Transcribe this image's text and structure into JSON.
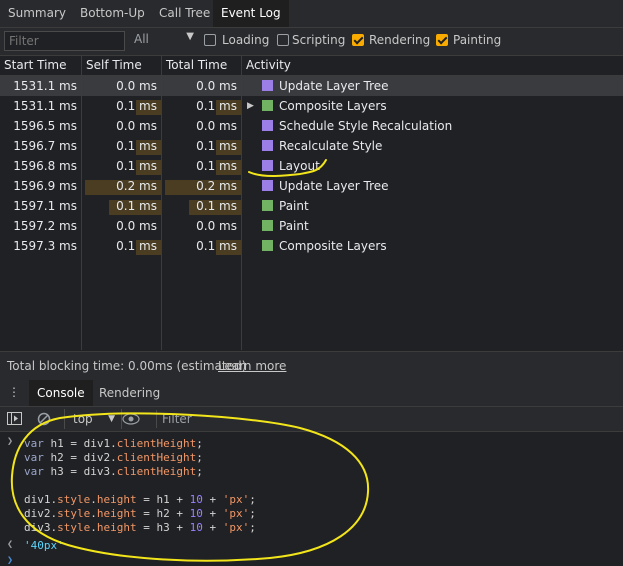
{
  "tabs": [
    {
      "label": "Summary",
      "active": false
    },
    {
      "label": "Bottom-Up",
      "active": false
    },
    {
      "label": "Call Tree",
      "active": false
    },
    {
      "label": "Event Log",
      "active": true
    }
  ],
  "filter": {
    "placeholder": "Filter",
    "level_select": "All",
    "checkboxes": [
      {
        "label": "Loading",
        "checked": false
      },
      {
        "label": "Scripting",
        "checked": false
      },
      {
        "label": "Rendering",
        "checked": true
      },
      {
        "label": "Painting",
        "checked": true
      }
    ]
  },
  "table": {
    "headers": [
      "Start Time",
      "Self Time",
      "Total Time",
      "Activity"
    ],
    "rows": [
      {
        "start": "1531.1 ms",
        "self": "0.0 ms",
        "total": "0.0 ms",
        "activity": "Update Layer Tree",
        "category": "rendering",
        "selected": true,
        "self_fraction": 0.0,
        "total_fraction": 0.0,
        "expandable": false
      },
      {
        "start": "1531.1 ms",
        "self": "0.1 ms",
        "total": "0.1 ms",
        "activity": "Composite Layers",
        "category": "painting",
        "selected": false,
        "self_fraction": 0.35,
        "total_fraction": 0.35,
        "expandable": true
      },
      {
        "start": "1596.5 ms",
        "self": "0.0 ms",
        "total": "0.0 ms",
        "activity": "Schedule Style Recalculation",
        "category": "rendering",
        "selected": false,
        "self_fraction": 0.0,
        "total_fraction": 0.0,
        "expandable": false
      },
      {
        "start": "1596.7 ms",
        "self": "0.1 ms",
        "total": "0.1 ms",
        "activity": "Recalculate Style",
        "category": "rendering",
        "selected": false,
        "self_fraction": 0.35,
        "total_fraction": 0.35,
        "expandable": false
      },
      {
        "start": "1596.8 ms",
        "self": "0.1 ms",
        "total": "0.1 ms",
        "activity": "Layout",
        "category": "rendering",
        "selected": false,
        "self_fraction": 0.35,
        "total_fraction": 0.35,
        "expandable": false
      },
      {
        "start": "1596.9 ms",
        "self": "0.2 ms",
        "total": "0.2 ms",
        "activity": "Update Layer Tree",
        "category": "rendering",
        "selected": false,
        "self_fraction": 1.0,
        "total_fraction": 1.0,
        "expandable": false
      },
      {
        "start": "1597.1 ms",
        "self": "0.1 ms",
        "total": "0.1 ms",
        "activity": "Paint",
        "category": "painting",
        "selected": false,
        "self_fraction": 0.7,
        "total_fraction": 0.7,
        "expandable": false
      },
      {
        "start": "1597.2 ms",
        "self": "0.0 ms",
        "total": "0.0 ms",
        "activity": "Paint",
        "category": "painting",
        "selected": false,
        "self_fraction": 0.0,
        "total_fraction": 0.0,
        "expandable": false
      },
      {
        "start": "1597.3 ms",
        "self": "0.1 ms",
        "total": "0.1 ms",
        "activity": "Composite Layers",
        "category": "painting",
        "selected": false,
        "self_fraction": 0.35,
        "total_fraction": 0.35,
        "expandable": false
      }
    ]
  },
  "colors": {
    "rendering": "#9b7fe6",
    "painting": "#71b363",
    "annotation": "#f2e51b"
  },
  "status": {
    "text": "Total blocking time: 0.00ms (estimated)",
    "link": "Learn more"
  },
  "drawer": {
    "menu_icon": "kebab-menu-icon",
    "tabs": [
      {
        "label": "Console",
        "active": true
      },
      {
        "label": "Rendering",
        "active": false
      }
    ]
  },
  "console_toolbar": {
    "context": "top",
    "filter_placeholder": "Filter"
  },
  "console": {
    "input_lines": [
      "var h1 = div1.clientHeight;",
      "var h2 = div2.clientHeight;",
      "var h3 = div3.clientHeight;",
      "",
      "div1.style.height = h1 + 10 + 'px';",
      "div2.style.height = h2 + 10 + 'px';",
      "div3.style.height = h3 + 10 + 'px';"
    ],
    "result": "'40px'"
  }
}
